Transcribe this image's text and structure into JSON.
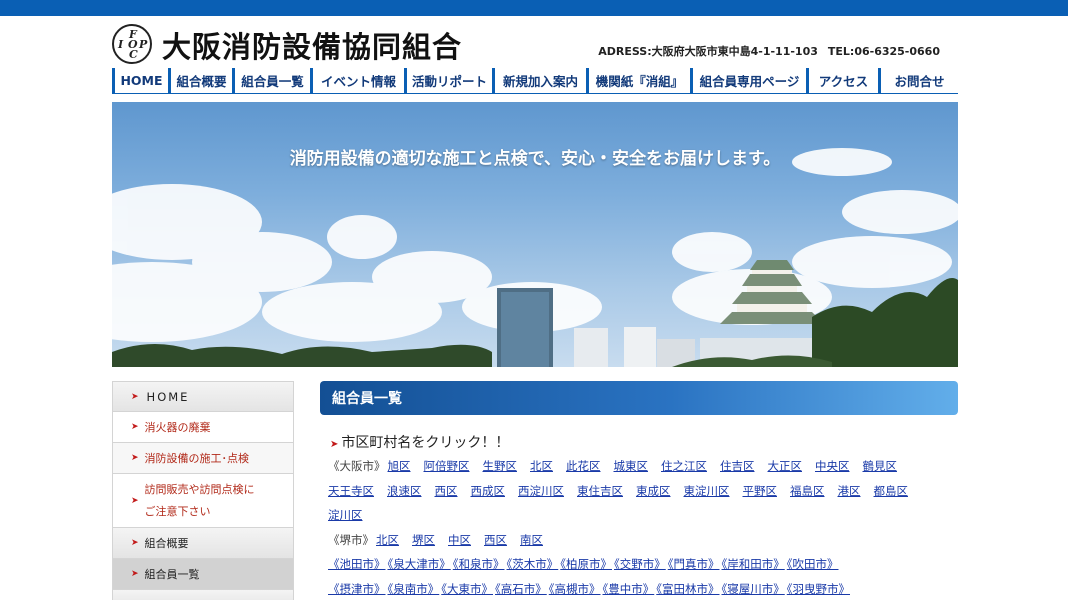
{
  "colors": {
    "brand_blue": "#0a5fb4",
    "link": "#1a3aa8",
    "accent_red": "#c21a1a"
  },
  "logo": {
    "letters": [
      "F",
      "I",
      "O",
      "P",
      "C"
    ]
  },
  "org_name": "大阪消防設備協同組合",
  "contact": {
    "address": "ADRESS:大阪府大阪市東中島4-1-11-103",
    "tel": "TEL:06-6325-0660"
  },
  "nav": [
    "HOME",
    "組合概要",
    "組合員一覧",
    "イベント情報",
    "活動リポート",
    "新規加入案内",
    "機関紙『消組』",
    "組合員専用ページ",
    "アクセス",
    "お問合せ"
  ],
  "hero": {
    "tagline": "消防用設備の適切な施工と点検で、安心・安全をお届けします。"
  },
  "sidebar": [
    {
      "label": "HOME"
    },
    {
      "label": "消火器の廃棄"
    },
    {
      "label": "消防設備の施工･点検"
    },
    {
      "label1": "訪問販売や訪問点検に",
      "label2": "ご注意下さい"
    },
    {
      "label": "組合概要"
    },
    {
      "label": "組合員一覧"
    }
  ],
  "main": {
    "title": "組合員一覧",
    "lead": "市区町村名をクリック！！",
    "osaka": {
      "prefix": "《大阪市》",
      "wards": [
        "旭区",
        "阿倍野区",
        "生野区",
        "北区",
        "此花区",
        "城東区",
        "住之江区",
        "住吉区",
        "大正区",
        "中央区",
        "鶴見区",
        "天王寺区",
        "浪速区",
        "西区",
        "西成区",
        "西淀川区",
        "東住吉区",
        "東成区",
        "東淀川区",
        "平野区",
        "福島区",
        "港区",
        "都島区",
        "淀川区"
      ]
    },
    "sakai": {
      "prefix": "《堺市》",
      "wards": [
        "北区",
        "堺区",
        "中区",
        "西区",
        "南区"
      ]
    },
    "cities": [
      "《池田市》",
      "《泉大津市》",
      "《和泉市》",
      "《茨木市》",
      "《柏原市》",
      "《交野市》",
      "《門真市》",
      "《岸和田市》",
      "《吹田市》",
      "《摂津市》",
      "《泉南市》",
      "《大東市》",
      "《高石市》",
      "《高槻市》",
      "《豊中市》",
      "《富田林市》",
      "《寝屋川市》",
      "《羽曳野市》"
    ]
  }
}
